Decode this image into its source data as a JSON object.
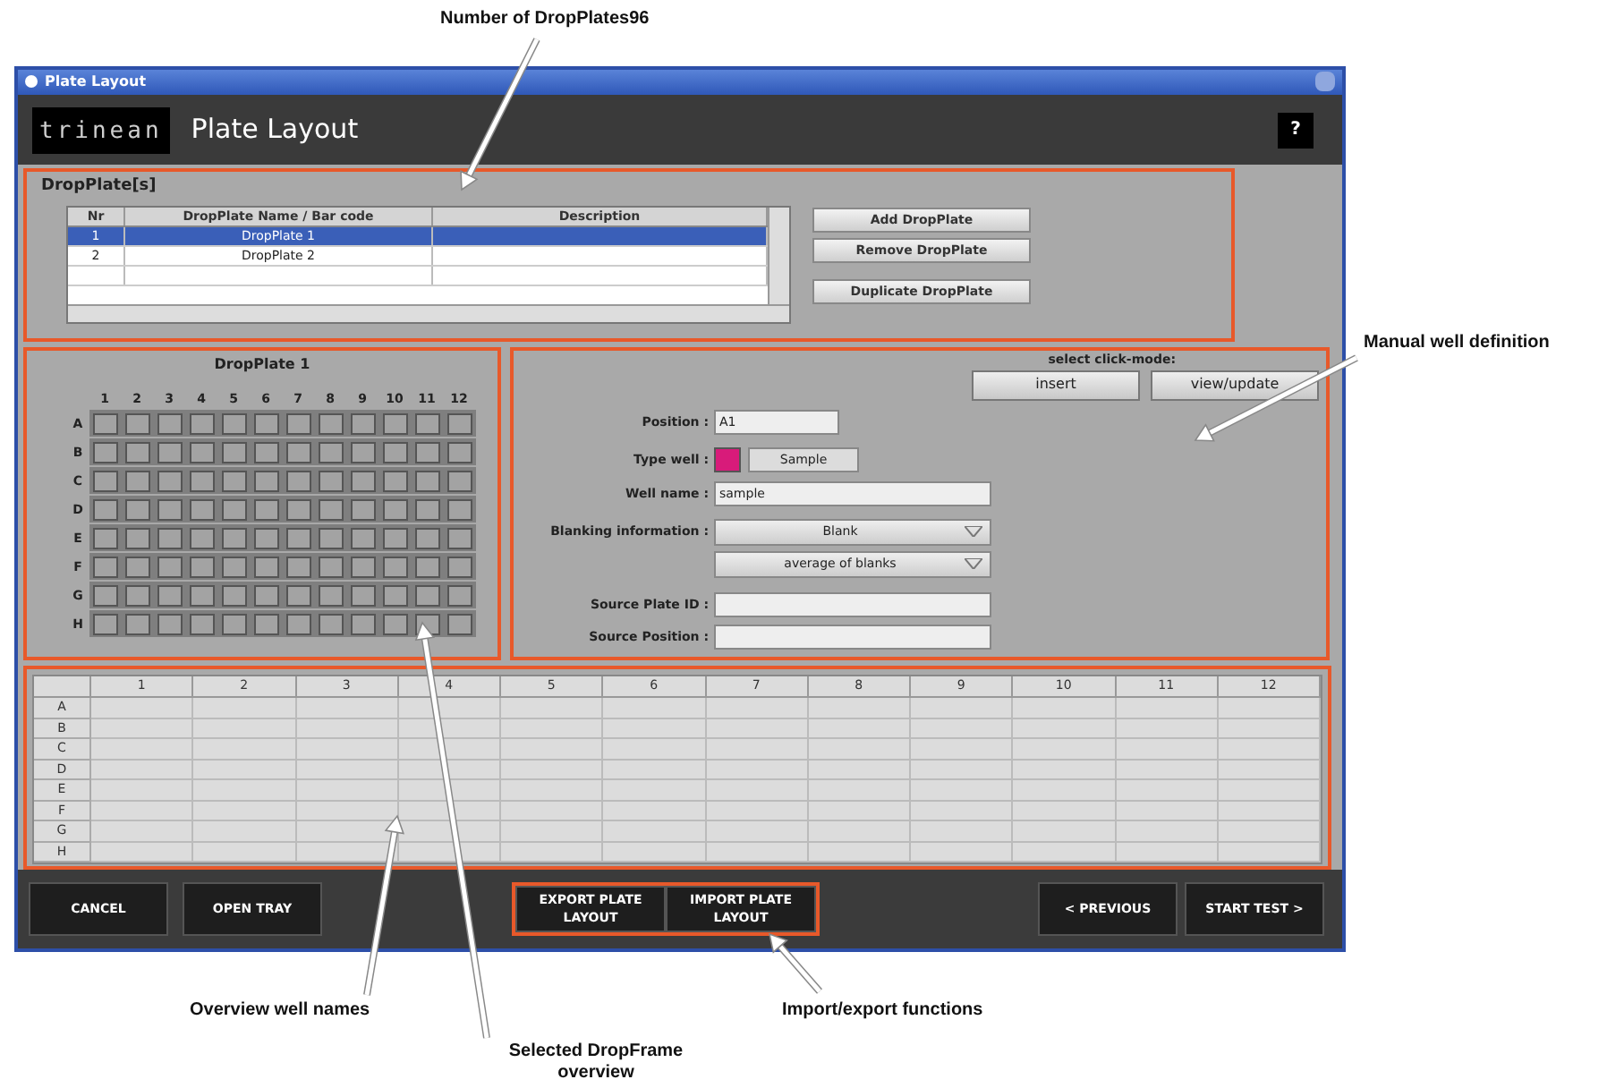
{
  "window": {
    "title": "Plate Layout"
  },
  "header": {
    "logo": "trinean",
    "title": "Plate Layout",
    "help": "?"
  },
  "dropplates": {
    "title": "DropPlate[s]",
    "columns": [
      "Nr",
      "DropPlate Name / Bar code",
      "Description"
    ],
    "rows": [
      {
        "nr": "1",
        "name": "DropPlate 1",
        "description": "",
        "selected": true
      },
      {
        "nr": "2",
        "name": "DropPlate 2",
        "description": "",
        "selected": false
      }
    ],
    "buttons": [
      "Add DropPlate",
      "Remove DropPlate",
      "Duplicate DropPlate"
    ]
  },
  "plate": {
    "title": "DropPlate 1",
    "columns": [
      "1",
      "2",
      "3",
      "4",
      "5",
      "6",
      "7",
      "8",
      "9",
      "10",
      "11",
      "12"
    ],
    "rows": [
      "A",
      "B",
      "C",
      "D",
      "E",
      "F",
      "G",
      "H"
    ]
  },
  "well_definition": {
    "click_mode_label": "select click-mode:",
    "modes": [
      "insert",
      "view/update"
    ],
    "position": {
      "label": "Position :",
      "value": "A1"
    },
    "type_well": {
      "label": "Type well :",
      "color": "#d81b7a",
      "value": "Sample"
    },
    "well_name": {
      "label": "Well name :",
      "value": "sample"
    },
    "blanking": {
      "label": "Blanking information :",
      "options": [
        "Blank",
        "average of blanks"
      ]
    },
    "source_plate_id": {
      "label": "Source Plate ID :"
    },
    "source_position": {
      "label": "Source Position :"
    }
  },
  "overview": {
    "columns": [
      "1",
      "2",
      "3",
      "4",
      "5",
      "6",
      "7",
      "8",
      "9",
      "10",
      "11",
      "12"
    ],
    "rows": [
      "A",
      "B",
      "C",
      "D",
      "E",
      "F",
      "G",
      "H"
    ]
  },
  "footer": {
    "left": [
      "CANCEL",
      "OPEN TRAY"
    ],
    "center": [
      "EXPORT PLATE LAYOUT",
      "IMPORT PLATE LAYOUT"
    ],
    "right": [
      "< PREVIOUS",
      "START TEST >"
    ]
  },
  "annotations": [
    {
      "text": "Number of DropPlates96"
    },
    {
      "text": "Manual well definition"
    },
    {
      "text": "Overview well names"
    },
    {
      "text": "Selected DropFrame overview"
    },
    {
      "text": "Import/export functions"
    }
  ]
}
